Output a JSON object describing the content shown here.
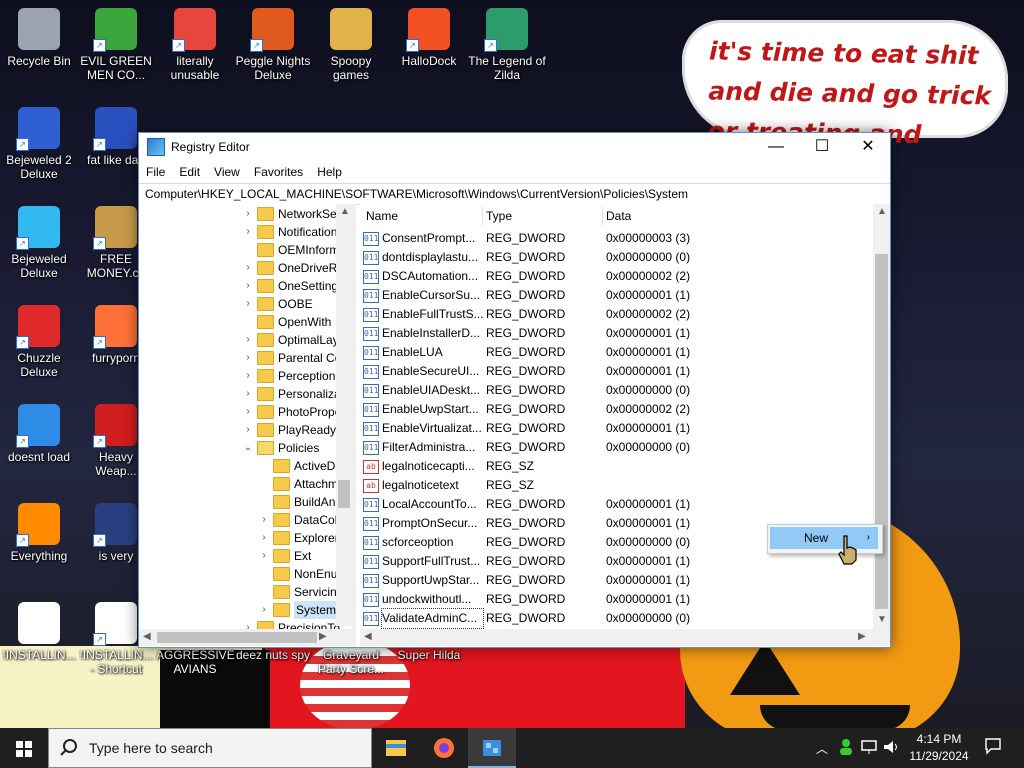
{
  "wallpaper": {
    "speech_bubble": "it's time to eat shit and die and go trick or treating and vote!"
  },
  "desktop_icons": [
    {
      "label": "Recycle Bin",
      "icon": "recycle-bin-icon",
      "color": "#9aa4b0",
      "shortcut": false
    },
    {
      "label": "EVIL GREEN MEN CO...",
      "icon": "green-men-icon",
      "color": "#3aa53a",
      "shortcut": true
    },
    {
      "label": "literally unusable",
      "icon": "chrome-icon",
      "color": "#e8453c",
      "shortcut": true
    },
    {
      "label": "Peggle Nights Deluxe",
      "icon": "peggle-icon",
      "color": "#e05a1e",
      "shortcut": true
    },
    {
      "label": "Spoopy games",
      "icon": "folder-icon",
      "color": "#e2b24a",
      "shortcut": false
    },
    {
      "label": "HalloDock",
      "icon": "windows-logo-icon",
      "color": "#f25022",
      "shortcut": true
    },
    {
      "label": "The Legend of Zilda",
      "icon": "zilda-icon",
      "color": "#2c9c6a",
      "shortcut": true
    },
    {
      "label": "Bejeweled 2 Deluxe",
      "icon": "bejeweled2-icon",
      "color": "#2f5fd0",
      "shortcut": true
    },
    {
      "label": "fat like darl",
      "icon": "mpl-icon",
      "color": "#2a50c0",
      "shortcut": true
    },
    {
      "label": "Bejeweled Deluxe",
      "icon": "gem-icon",
      "color": "#32b9ef",
      "shortcut": true
    },
    {
      "label": "FREE MONEY.co",
      "icon": "money-bag-icon",
      "color": "#c79a4a",
      "shortcut": true
    },
    {
      "label": "Chuzzle Deluxe",
      "icon": "chuzzle-icon",
      "color": "#e02a2a",
      "shortcut": true
    },
    {
      "label": "furryporn",
      "icon": "firefox-icon",
      "color": "#ff7139",
      "shortcut": true
    },
    {
      "label": "doesnt load",
      "icon": "thunderbird-icon",
      "color": "#2f8ce6",
      "shortcut": true
    },
    {
      "label": "Heavy Weap...",
      "icon": "radiation-icon",
      "color": "#d11e1e",
      "shortcut": true
    },
    {
      "label": "Everything",
      "icon": "search-ring-icon",
      "color": "#ff8a00",
      "shortcut": true
    },
    {
      "label": "is very",
      "icon": "shield-icon",
      "color": "#2a3f80",
      "shortcut": true
    },
    {
      "label": "!INSTALLIN...",
      "icon": "text-file-icon",
      "color": "#ffffff",
      "shortcut": false
    },
    {
      "label": "!INSTALLIN... - Shortcut",
      "icon": "text-file-icon",
      "color": "#ffffff",
      "shortcut": true
    },
    {
      "label": "AGGRESSIVE AVIANS",
      "icon": "app-icon",
      "color": "#888888",
      "shortcut": false
    },
    {
      "label": "deez nuts spy",
      "icon": "app-icon",
      "color": "#888888",
      "shortcut": false
    },
    {
      "label": "Graveyard Party Scre...",
      "icon": "app-icon",
      "color": "#888888",
      "shortcut": false
    },
    {
      "label": "Super Hilda",
      "icon": "app-icon",
      "color": "#888888",
      "shortcut": false
    }
  ],
  "window": {
    "title": "Registry Editor",
    "controls": {
      "minimize": "—",
      "maximize": "☐",
      "close": "✕"
    },
    "menu": [
      "File",
      "Edit",
      "View",
      "Favorites",
      "Help"
    ],
    "address": "Computer\\HKEY_LOCAL_MACHINE\\SOFTWARE\\Microsoft\\Windows\\CurrentVersion\\Policies\\System",
    "tree": [
      {
        "label": "NetworkSer",
        "level": 0,
        "expander": "›",
        "selected": false
      },
      {
        "label": "Notification",
        "level": 0,
        "expander": "›",
        "selected": false
      },
      {
        "label": "OEMInform",
        "level": 0,
        "expander": "",
        "selected": false
      },
      {
        "label": "OneDriveRa",
        "level": 0,
        "expander": "›",
        "selected": false
      },
      {
        "label": "OneSetting",
        "level": 0,
        "expander": "›",
        "selected": false
      },
      {
        "label": "OOBE",
        "level": 0,
        "expander": "›",
        "selected": false
      },
      {
        "label": "OpenWith",
        "level": 0,
        "expander": "",
        "selected": false
      },
      {
        "label": "OptimalLay",
        "level": 0,
        "expander": "›",
        "selected": false
      },
      {
        "label": "Parental Co",
        "level": 0,
        "expander": "›",
        "selected": false
      },
      {
        "label": "Perception",
        "level": 0,
        "expander": "›",
        "selected": false
      },
      {
        "label": "Personaliza",
        "level": 0,
        "expander": "›",
        "selected": false
      },
      {
        "label": "PhotoPropo",
        "level": 0,
        "expander": "›",
        "selected": false
      },
      {
        "label": "PlayReady",
        "level": 0,
        "expander": "›",
        "selected": false
      },
      {
        "label": "Policies",
        "level": 0,
        "expander": "⌄",
        "selected": false
      },
      {
        "label": "ActiveDe",
        "level": 1,
        "expander": "",
        "selected": false
      },
      {
        "label": "Attachm",
        "level": 1,
        "expander": "",
        "selected": false
      },
      {
        "label": "BuildAn",
        "level": 1,
        "expander": "",
        "selected": false
      },
      {
        "label": "DataCol",
        "level": 1,
        "expander": "›",
        "selected": false
      },
      {
        "label": "Explorer",
        "level": 1,
        "expander": "›",
        "selected": false
      },
      {
        "label": "Ext",
        "level": 1,
        "expander": "›",
        "selected": false
      },
      {
        "label": "NonEnu",
        "level": 1,
        "expander": "",
        "selected": false
      },
      {
        "label": "Servicin",
        "level": 1,
        "expander": "",
        "selected": false
      },
      {
        "label": "System",
        "level": 1,
        "expander": "›",
        "selected": true
      },
      {
        "label": "PrecisionTo",
        "level": 0,
        "expander": "›",
        "selected": false
      }
    ],
    "columns": {
      "name": "Name",
      "type": "Type",
      "data": "Data"
    },
    "values": [
      {
        "name": "ConsentPrompt...",
        "type": "REG_DWORD",
        "data": "0x00000003 (3)",
        "kind": "dword"
      },
      {
        "name": "dontdisplaylastu...",
        "type": "REG_DWORD",
        "data": "0x00000000 (0)",
        "kind": "dword"
      },
      {
        "name": "DSCAutomation...",
        "type": "REG_DWORD",
        "data": "0x00000002 (2)",
        "kind": "dword"
      },
      {
        "name": "EnableCursorSu...",
        "type": "REG_DWORD",
        "data": "0x00000001 (1)",
        "kind": "dword"
      },
      {
        "name": "EnableFullTrustS...",
        "type": "REG_DWORD",
        "data": "0x00000002 (2)",
        "kind": "dword"
      },
      {
        "name": "EnableInstallerD...",
        "type": "REG_DWORD",
        "data": "0x00000001 (1)",
        "kind": "dword"
      },
      {
        "name": "EnableLUA",
        "type": "REG_DWORD",
        "data": "0x00000001 (1)",
        "kind": "dword"
      },
      {
        "name": "EnableSecureUI...",
        "type": "REG_DWORD",
        "data": "0x00000001 (1)",
        "kind": "dword"
      },
      {
        "name": "EnableUIADeskt...",
        "type": "REG_DWORD",
        "data": "0x00000000 (0)",
        "kind": "dword"
      },
      {
        "name": "EnableUwpStart...",
        "type": "REG_DWORD",
        "data": "0x00000002 (2)",
        "kind": "dword"
      },
      {
        "name": "EnableVirtualizat...",
        "type": "REG_DWORD",
        "data": "0x00000001 (1)",
        "kind": "dword"
      },
      {
        "name": "FilterAdministra...",
        "type": "REG_DWORD",
        "data": "0x00000000 (0)",
        "kind": "dword"
      },
      {
        "name": "legalnoticecapti...",
        "type": "REG_SZ",
        "data": "",
        "kind": "sz"
      },
      {
        "name": "legalnoticetext",
        "type": "REG_SZ",
        "data": "",
        "kind": "sz"
      },
      {
        "name": "LocalAccountTo...",
        "type": "REG_DWORD",
        "data": "0x00000001 (1)",
        "kind": "dword"
      },
      {
        "name": "PromptOnSecur...",
        "type": "REG_DWORD",
        "data": "0x00000001 (1)",
        "kind": "dword"
      },
      {
        "name": "scforceoption",
        "type": "REG_DWORD",
        "data": "0x00000000 (0)",
        "kind": "dword"
      },
      {
        "name": "SupportFullTrust...",
        "type": "REG_DWORD",
        "data": "0x00000001 (1)",
        "kind": "dword"
      },
      {
        "name": "SupportUwpStar...",
        "type": "REG_DWORD",
        "data": "0x00000001 (1)",
        "kind": "dword"
      },
      {
        "name": "undockwithoutl...",
        "type": "REG_DWORD",
        "data": "0x00000001 (1)",
        "kind": "dword"
      },
      {
        "name": "ValidateAdminC...",
        "type": "REG_DWORD",
        "data": "0x00000000 (0)",
        "kind": "dword",
        "focused": true
      }
    ],
    "context_menu": {
      "label": "New",
      "arrow": "›"
    }
  },
  "taskbar": {
    "search_placeholder": "Type here to search",
    "apps": [
      {
        "icon": "file-explorer-icon",
        "active": false
      },
      {
        "icon": "firefox-icon",
        "active": false
      },
      {
        "icon": "registry-editor-icon",
        "active": true
      }
    ],
    "time": "4:14 PM",
    "date": "11/29/2024"
  }
}
